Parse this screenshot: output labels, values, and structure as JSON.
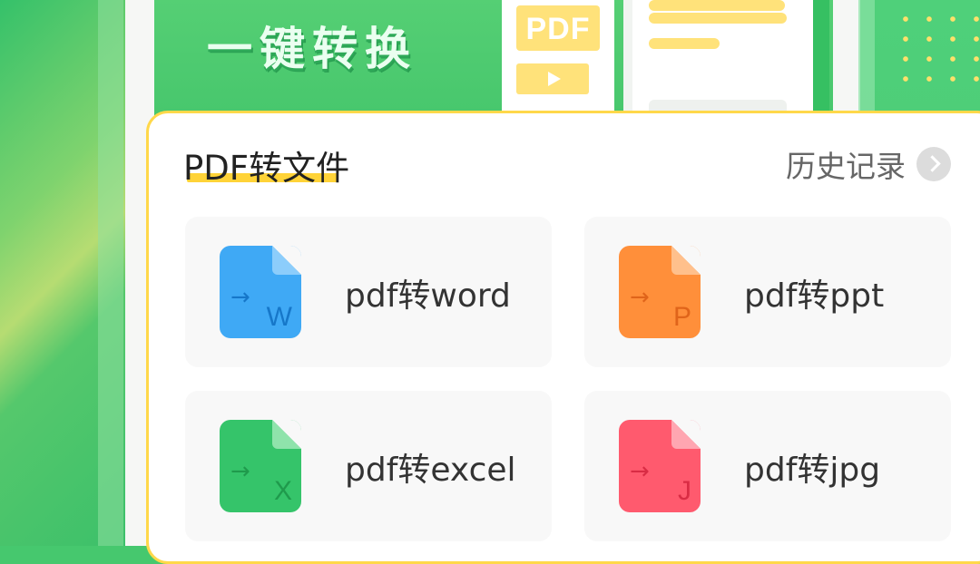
{
  "banner": {
    "title": "一键转换",
    "pdf_badge": "PDF",
    "pdf_badge_icon": "pdf-doc-icon",
    "play_icon": "play-icon"
  },
  "section": {
    "title": "PDF转文件",
    "history_label": "历史记录",
    "history_icon": "chevron-right-icon"
  },
  "tools": [
    {
      "label": "pdf转word",
      "icon_letter": "W",
      "icon_arrow": "→",
      "color": "#3fa9f5"
    },
    {
      "label": "pdf转ppt",
      "icon_letter": "P",
      "icon_arrow": "→",
      "color": "#ff8f3a"
    },
    {
      "label": "pdf转excel",
      "icon_letter": "X",
      "icon_arrow": "→",
      "color": "#35c46a"
    },
    {
      "label": "pdf转jpg",
      "icon_letter": "J",
      "icon_arrow": "→",
      "color": "#ff5a6e"
    }
  ],
  "colors": {
    "brand_green": "#46c86e",
    "accent_yellow": "#ffd84a"
  }
}
